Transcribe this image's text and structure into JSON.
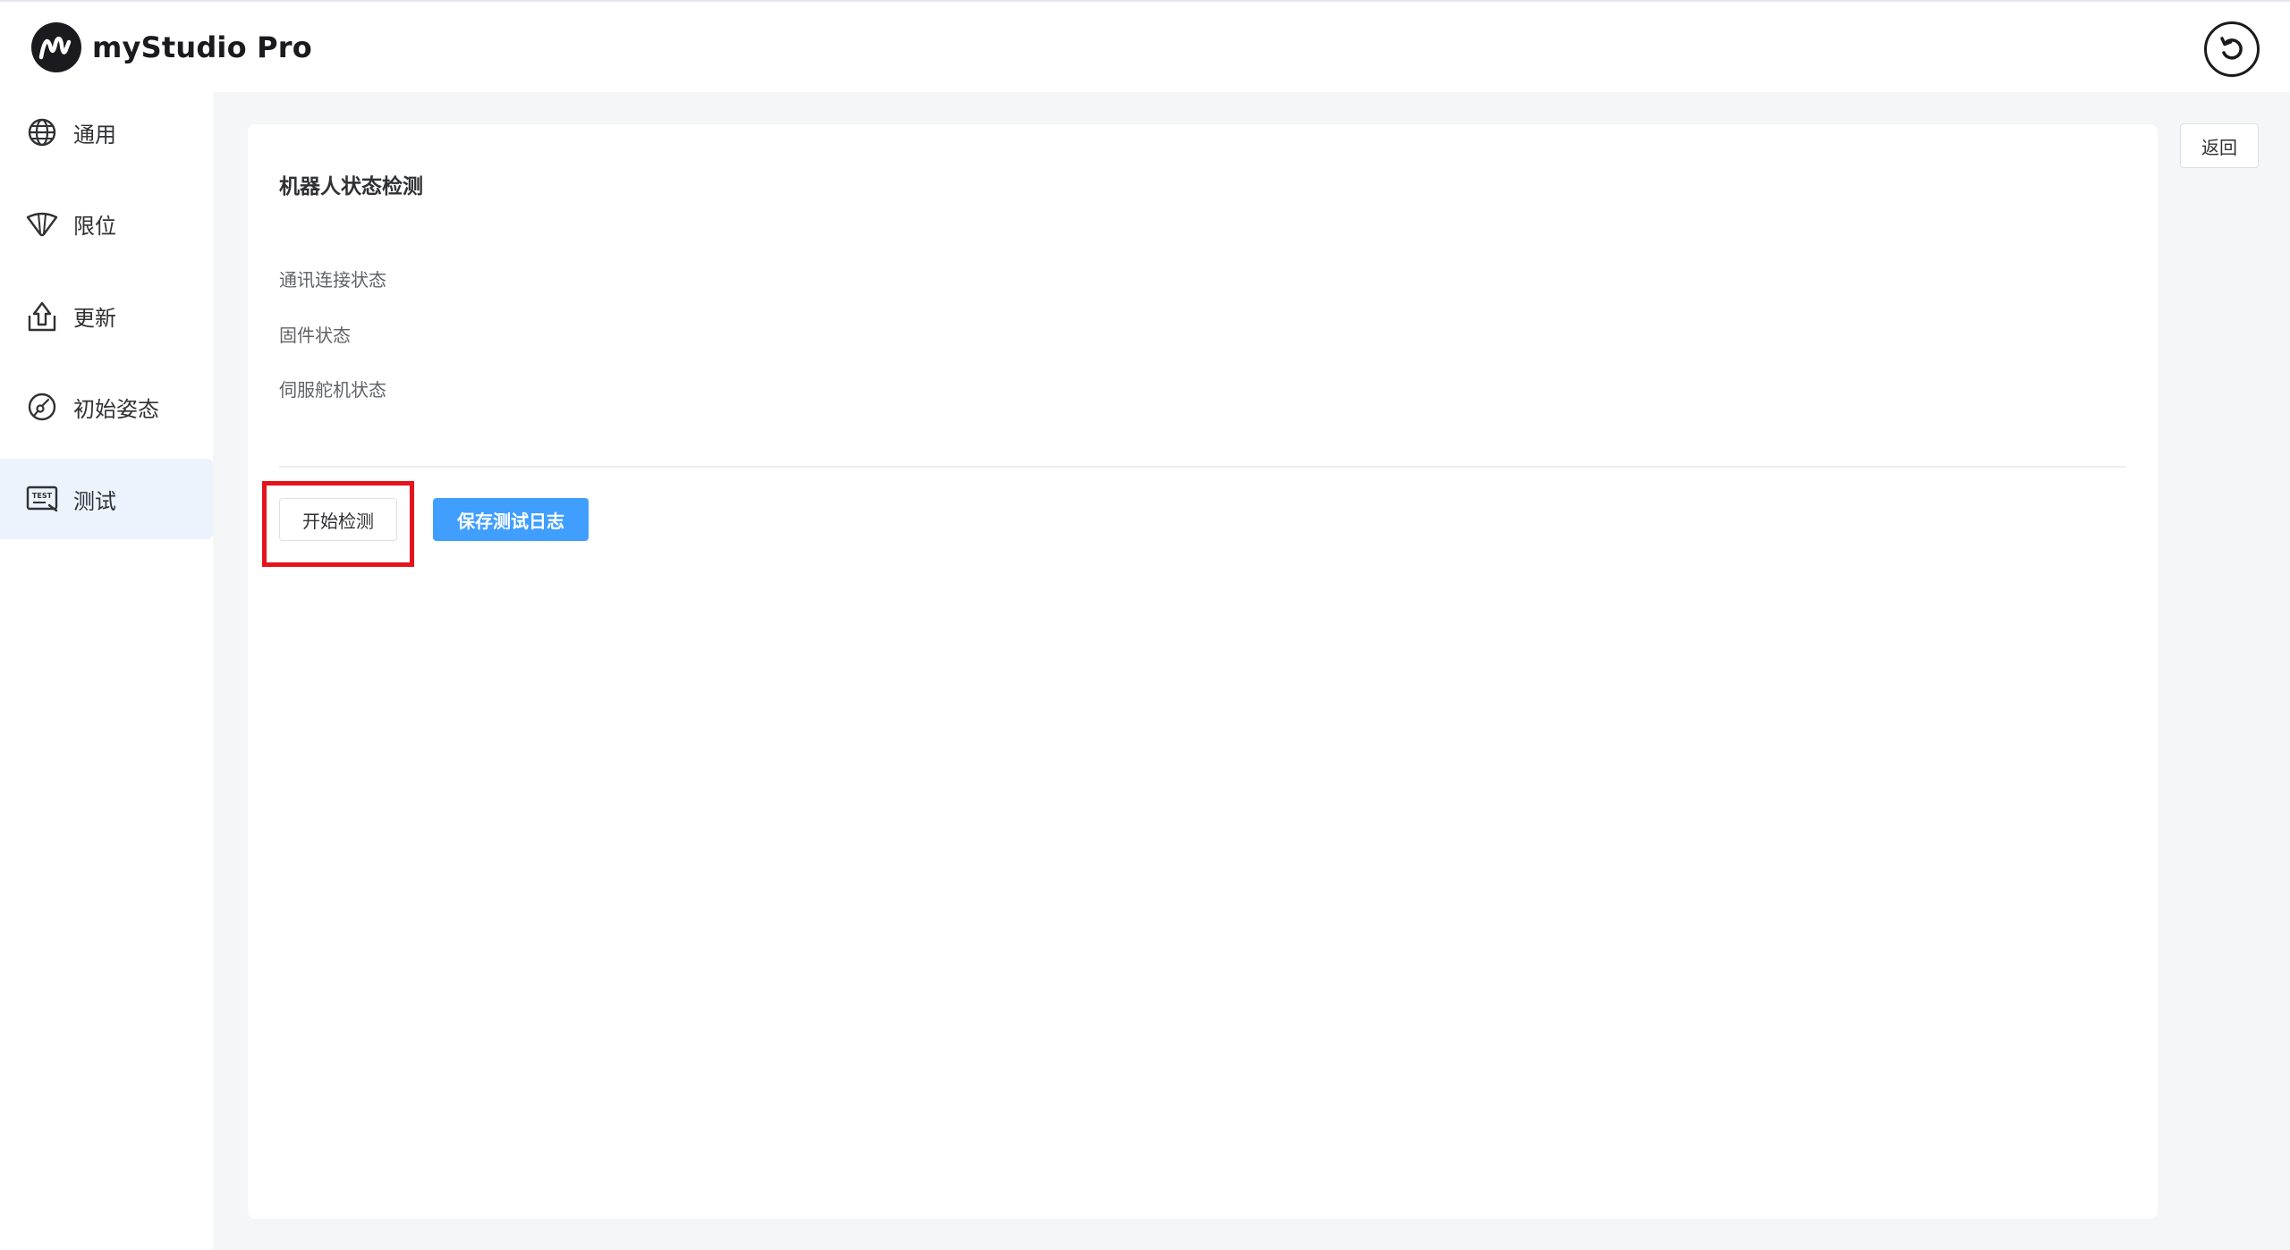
{
  "app": {
    "name": "myStudio Pro",
    "logo_icon": "mystudio-logo-icon"
  },
  "header": {
    "undo_icon": "undo-icon"
  },
  "sidebar": {
    "items": [
      {
        "label": "通用",
        "icon": "globe-icon",
        "active": false
      },
      {
        "label": "限位",
        "icon": "limit-icon",
        "active": false
      },
      {
        "label": "更新",
        "icon": "upload-update-icon",
        "active": false
      },
      {
        "label": "初始姿态",
        "icon": "pose-icon",
        "active": false
      },
      {
        "label": "测试",
        "icon": "test-icon",
        "active": true
      }
    ]
  },
  "main": {
    "back_label": "返回",
    "card": {
      "title": "机器人状态检测",
      "status_items": [
        "通讯连接状态",
        "固件状态",
        "伺服舵机状态"
      ],
      "start_button_label": "开始检测",
      "save_log_button_label": "保存测试日志"
    }
  },
  "colors": {
    "primary": "#409eff",
    "active_nav_bg": "#ecf3fd",
    "highlight": "#e3141d",
    "page_bg": "#f5f6f8"
  }
}
